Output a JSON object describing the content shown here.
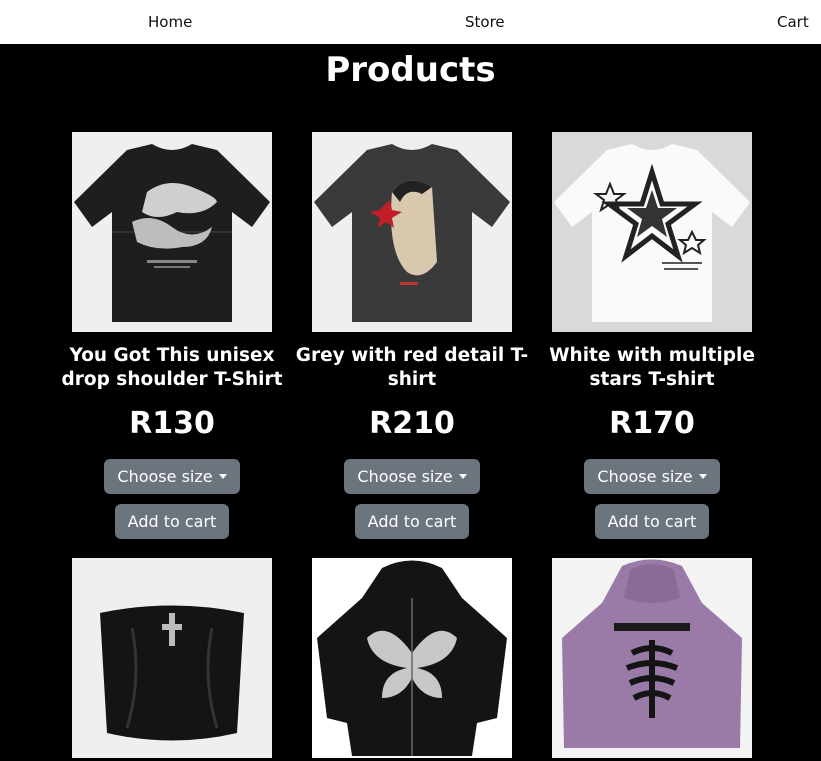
{
  "nav": {
    "home": "Home",
    "store": "Store",
    "cart": "Cart"
  },
  "page_title": "Products",
  "products": [
    {
      "name": "You Got This unisex drop shoulder T-Shirt",
      "price": "R130",
      "size_label": "Choose size",
      "cart_label": "Add to cart"
    },
    {
      "name": "Grey with red detail T-shirt",
      "price": "R210",
      "size_label": "Choose size",
      "cart_label": "Add to cart"
    },
    {
      "name": "White with multiple stars T-shirt",
      "price": "R170",
      "size_label": "Choose size",
      "cart_label": "Add to cart"
    }
  ],
  "colors": {
    "background": "#000000",
    "nav": "#ffffff",
    "button": "#6c757d"
  }
}
